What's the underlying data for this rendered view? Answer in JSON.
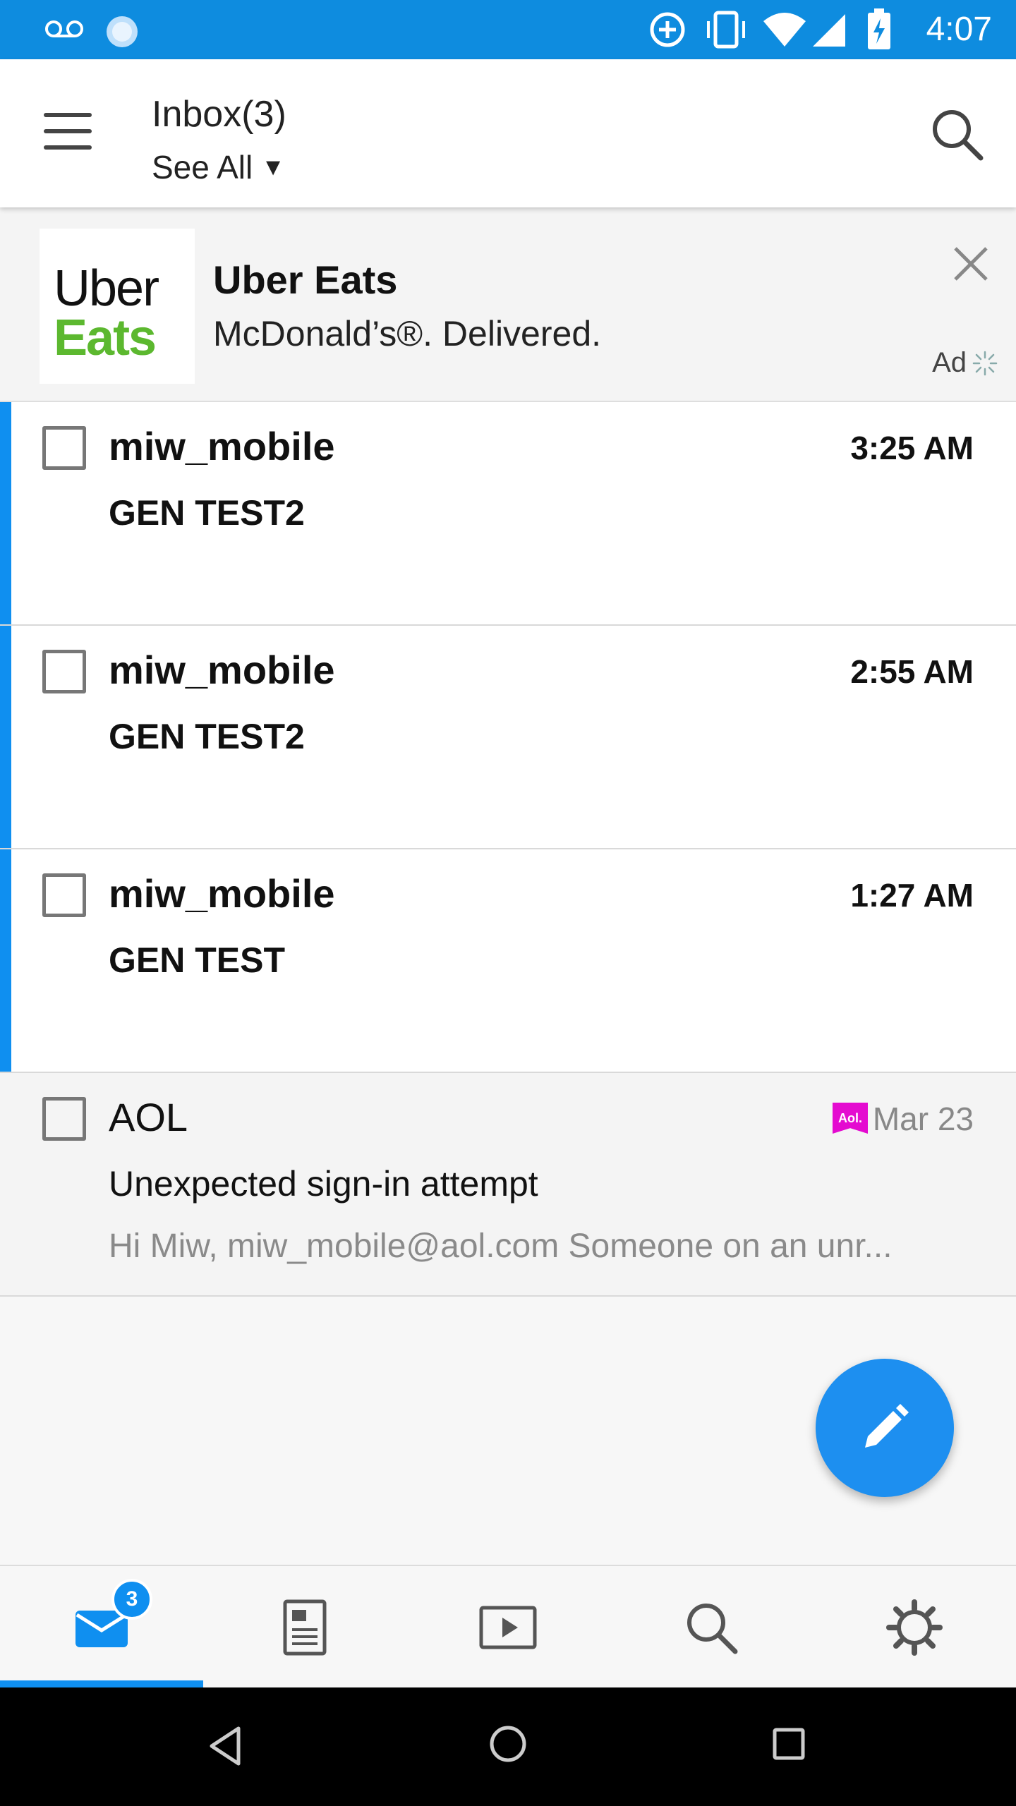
{
  "status_bar": {
    "time": "4:07",
    "icons": [
      "voicemail-icon",
      "sync-icon",
      "data-saver-icon",
      "vibrate-icon",
      "wifi-icon",
      "signal-icon",
      "battery-charging-icon"
    ]
  },
  "app_bar": {
    "folder_title": "Inbox(3)",
    "filter_label": "See All",
    "filter_caret": "▼",
    "menu_icon": "menu-icon",
    "search_icon": "search-icon"
  },
  "ad": {
    "logo_line1": "Uber",
    "logo_line2": "Eats",
    "title": "Uber Eats",
    "subtitle": "McDonald’s®. Delivered.",
    "label": "Ad",
    "brand_color": "#5cb82f"
  },
  "messages": [
    {
      "sender": "miw_mobile",
      "subject": "GEN TEST2",
      "time": "3:25 AM",
      "preview": "",
      "unread": true
    },
    {
      "sender": "miw_mobile",
      "subject": "GEN TEST2",
      "time": "2:55 AM",
      "preview": "",
      "unread": true
    },
    {
      "sender": "miw_mobile",
      "subject": "GEN TEST",
      "time": "1:27 AM",
      "preview": "",
      "unread": true
    },
    {
      "sender": "AOL",
      "subject": "Unexpected sign-in attempt",
      "time": "Mar 23",
      "preview": "Hi Miw, miw_mobile@aol.com Someone on an unr...",
      "unread": false,
      "badge": "Aol."
    }
  ],
  "bottom_nav": {
    "items": [
      "mail-icon",
      "news-icon",
      "video-icon",
      "search-icon",
      "settings-icon"
    ],
    "mail_badge": "3",
    "active_index": 0
  },
  "colors": {
    "accent": "#0f8ff0",
    "status_bar": "#0e8cdf",
    "aol_badge": "#e40bd0"
  }
}
